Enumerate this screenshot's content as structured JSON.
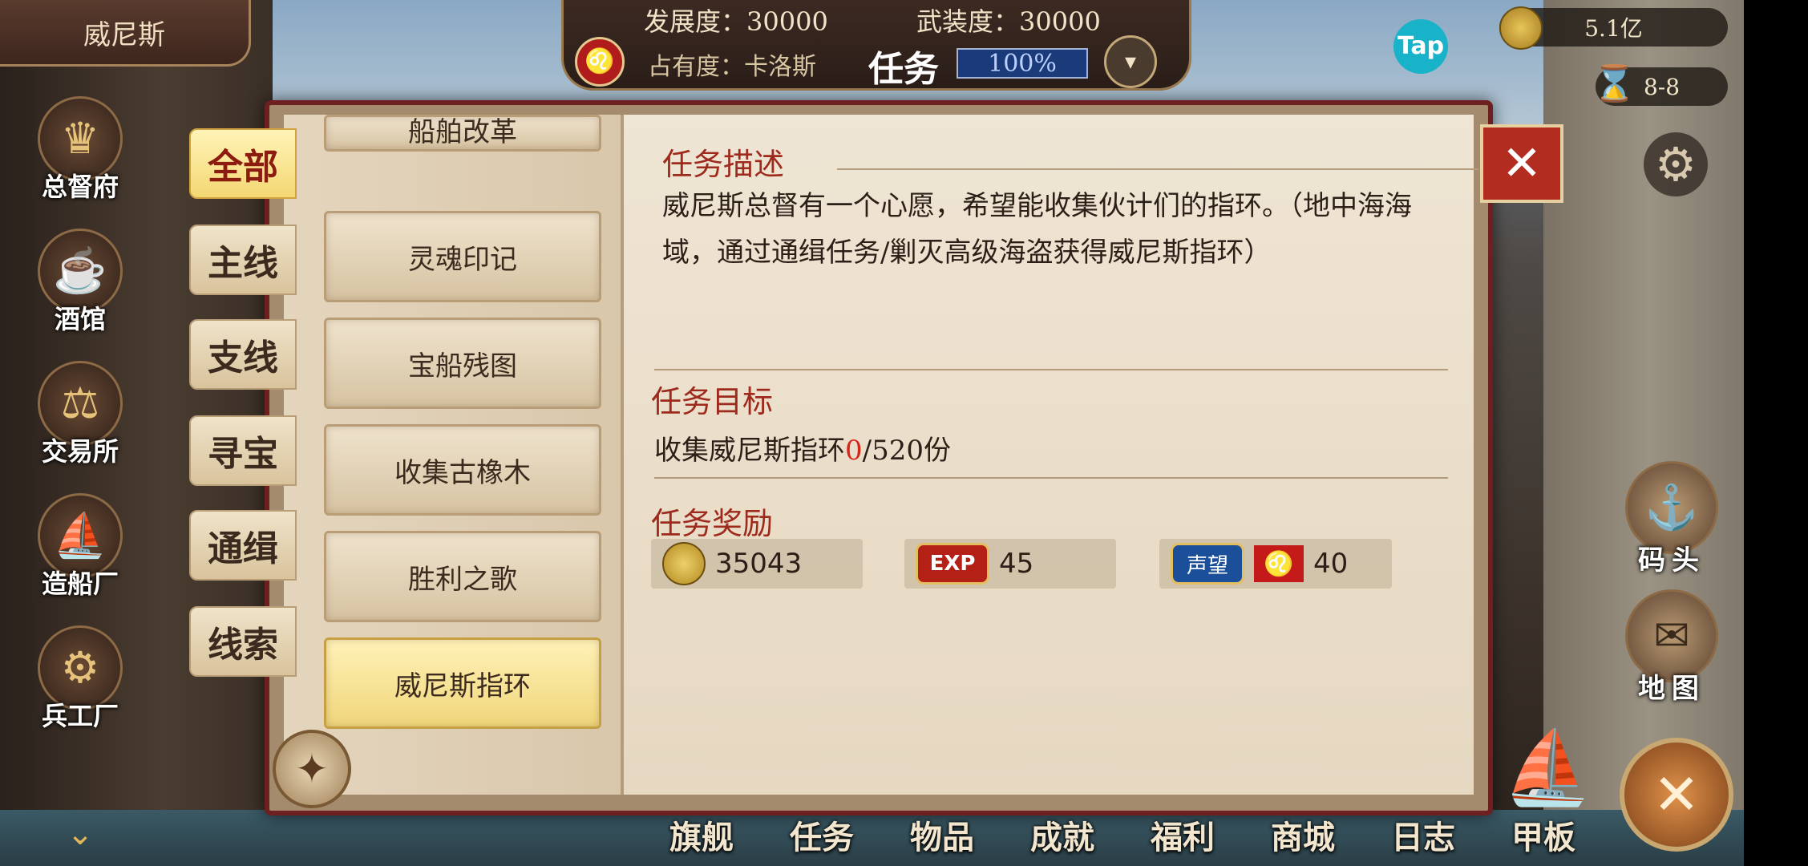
{
  "city": "威尼斯",
  "top": {
    "development": "发展度：30000",
    "armament": "武装度：30000",
    "ownership_label": "占有度：卡洛斯",
    "title": "任务",
    "ownership_pct": "100%"
  },
  "top_right": {
    "gold": "5.1亿",
    "time": "8-8"
  },
  "side_buildings": [
    {
      "label": "总督府",
      "icon": "crown-icon"
    },
    {
      "label": "酒馆",
      "icon": "beer-mug-icon"
    },
    {
      "label": "交易所",
      "icon": "scales-icon"
    },
    {
      "label": "造船厂",
      "icon": "ship-icon"
    },
    {
      "label": "兵工厂",
      "icon": "cannon-icon"
    }
  ],
  "categories": [
    "全部",
    "主线",
    "支线",
    "寻宝",
    "通缉",
    "线索"
  ],
  "active_category": "全部",
  "tasks": [
    "船舶改革",
    "灵魂印记",
    "宝船残图",
    "收集古橡木",
    "胜利之歌",
    "威尼斯指环"
  ],
  "selected_task": "威尼斯指环",
  "detail": {
    "desc_heading": "任务描述",
    "desc_text": "威尼斯总督有一个心愿，希望能收集伙计们的指环。（地中海海域，通过通缉任务/剿灭高级海盗获得威尼斯指环）",
    "goal_heading": "任务目标",
    "goal_prefix": "收集威尼斯指环",
    "goal_current": "0",
    "goal_suffix": "/520份",
    "reward_heading": "任务奖励",
    "rewards": [
      {
        "icon": "gold-coin-icon",
        "value": "35043"
      },
      {
        "icon": "exp-icon",
        "label": "EXP",
        "value": "45"
      },
      {
        "icon": "reputation-icon",
        "label": "声望",
        "value": "40"
      }
    ]
  },
  "right_buttons": [
    "码头",
    "地图"
  ],
  "bottom_nav": [
    "旗舰",
    "任务",
    "物品",
    "成就",
    "福利",
    "商城",
    "日志",
    "甲板"
  ]
}
